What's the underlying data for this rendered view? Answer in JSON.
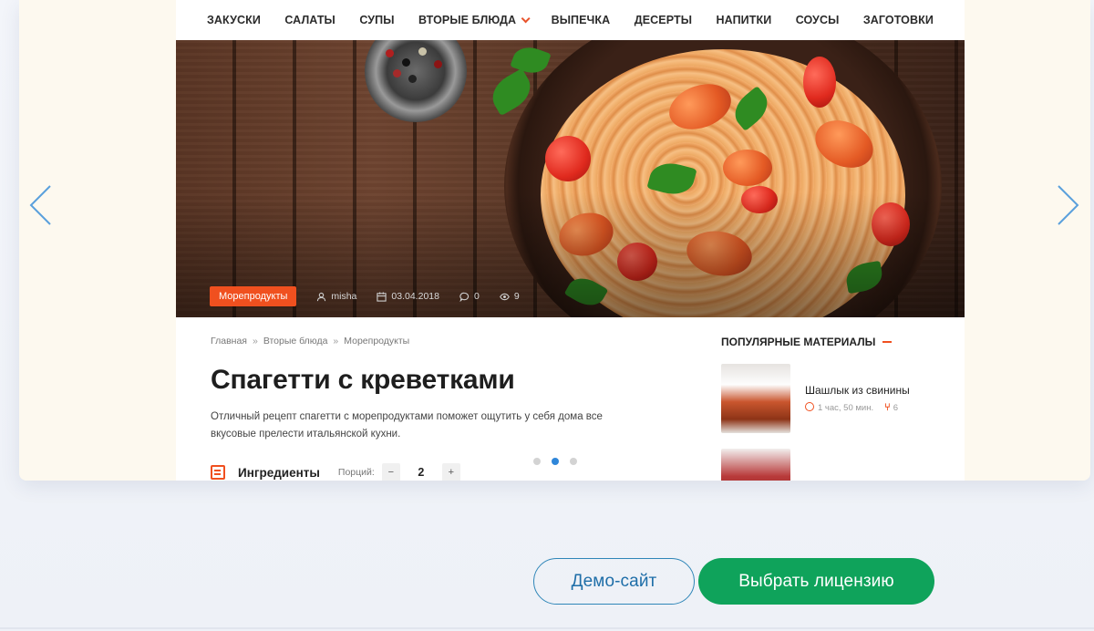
{
  "nav": {
    "items": [
      {
        "label": "ЗАКУСКИ"
      },
      {
        "label": "САЛАТЫ"
      },
      {
        "label": "СУПЫ"
      },
      {
        "label": "ВТОРЫЕ БЛЮДА",
        "dropdown": true
      },
      {
        "label": "ВЫПЕЧКА"
      },
      {
        "label": "ДЕСЕРТЫ"
      },
      {
        "label": "НАПИТКИ"
      },
      {
        "label": "СОУСЫ"
      },
      {
        "label": "ЗАГОТОВКИ"
      }
    ]
  },
  "hero": {
    "category": "Морепродукты",
    "author": "misha",
    "date": "03.04.2018",
    "comments": "0",
    "views": "9"
  },
  "breadcrumb": {
    "items": [
      "Главная",
      "Вторые блюда",
      "Морепродукты"
    ],
    "separator": "»"
  },
  "article": {
    "title": "Спагетти с креветками",
    "lead": "Отличный рецепт спагетти с морепродуктами поможет ощутить у себя дома все вкусовые прелести итальянской кухни."
  },
  "ingredients": {
    "title": "Ингредиенты",
    "portions_label": "Порций:",
    "minus": "−",
    "plus": "+",
    "portions_value": "2"
  },
  "sidebar": {
    "title": "ПОПУЛЯРНЫЕ МАТЕРИАЛЫ",
    "items": [
      {
        "name": "Шашлык из свинины",
        "time": "1 час, 50 мин.",
        "servings": "6"
      }
    ]
  },
  "slider": {
    "total_dots": 3,
    "active_dot": 1
  },
  "buttons": {
    "demo": "Демо-сайт",
    "license": "Выбрать лицензию"
  },
  "colors": {
    "accent_orange": "#f0501f",
    "license_green": "#0fa35b",
    "demo_blue": "#2f86b8",
    "dot_active": "#2f86d9",
    "arrow": "#5aa0dc"
  }
}
